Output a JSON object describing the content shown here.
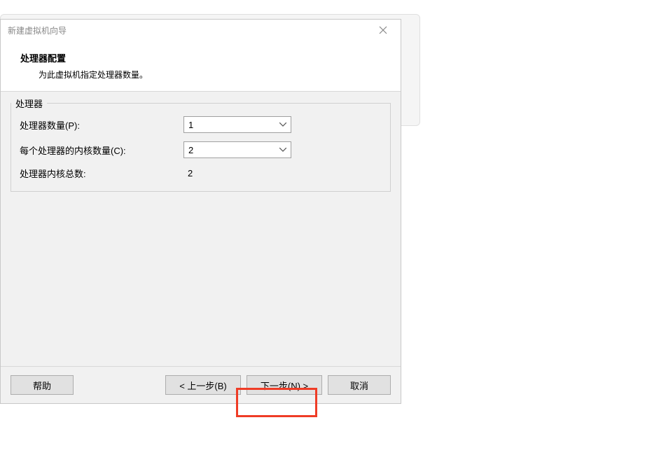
{
  "titlebar": {
    "title": "新建虚拟机向导"
  },
  "header": {
    "title": "处理器配置",
    "subtitle": "为此虚拟机指定处理器数量。"
  },
  "fieldset": {
    "legend": "处理器",
    "processors_label": "处理器数量(P):",
    "processors_value": "1",
    "cores_label": "每个处理器的内核数量(C):",
    "cores_value": "2",
    "total_label": "处理器内核总数:",
    "total_value": "2"
  },
  "footer": {
    "help": "帮助",
    "back": "< 上一步(B)",
    "next": "下一步(N) >",
    "cancel": "取消"
  }
}
